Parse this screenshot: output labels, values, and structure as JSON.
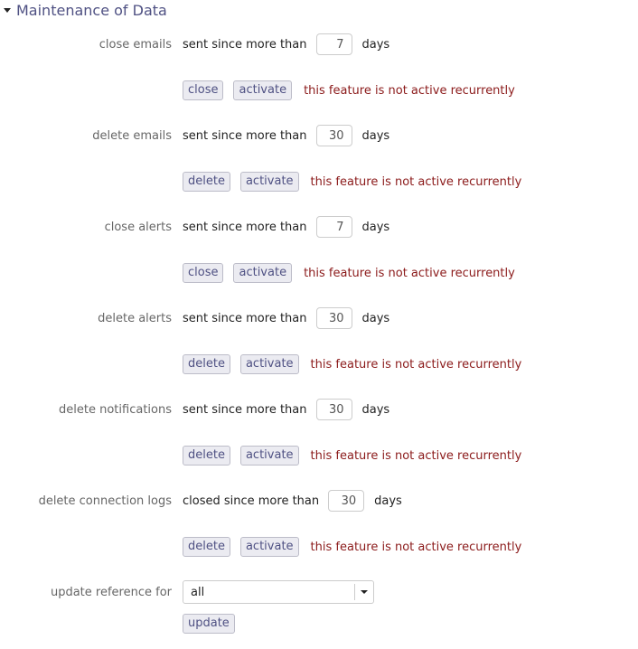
{
  "section": {
    "title": "Maintenance of Data"
  },
  "items": [
    {
      "label": "close emails",
      "prefix": "sent since more than",
      "value": "7",
      "unit": "days",
      "action": "close",
      "activate": "activate",
      "status": "this feature is not active recurrently"
    },
    {
      "label": "delete emails",
      "prefix": "sent since more than",
      "value": "30",
      "unit": "days",
      "action": "delete",
      "activate": "activate",
      "status": "this feature is not active recurrently"
    },
    {
      "label": "close alerts",
      "prefix": "sent since more than",
      "value": "7",
      "unit": "days",
      "action": "close",
      "activate": "activate",
      "status": "this feature is not active recurrently"
    },
    {
      "label": "delete alerts",
      "prefix": "sent since more than",
      "value": "30",
      "unit": "days",
      "action": "delete",
      "activate": "activate",
      "status": "this feature is not active recurrently"
    },
    {
      "label": "delete notifications",
      "prefix": "sent since more than",
      "value": "30",
      "unit": "days",
      "action": "delete",
      "activate": "activate",
      "status": "this feature is not active recurrently"
    },
    {
      "label": "delete connection logs",
      "prefix": "closed since more than",
      "value": "30",
      "unit": "days",
      "action": "delete",
      "activate": "activate",
      "status": "this feature is not active recurrently"
    }
  ],
  "update_reference": {
    "label": "update reference for",
    "selected": "all",
    "button": "update"
  }
}
